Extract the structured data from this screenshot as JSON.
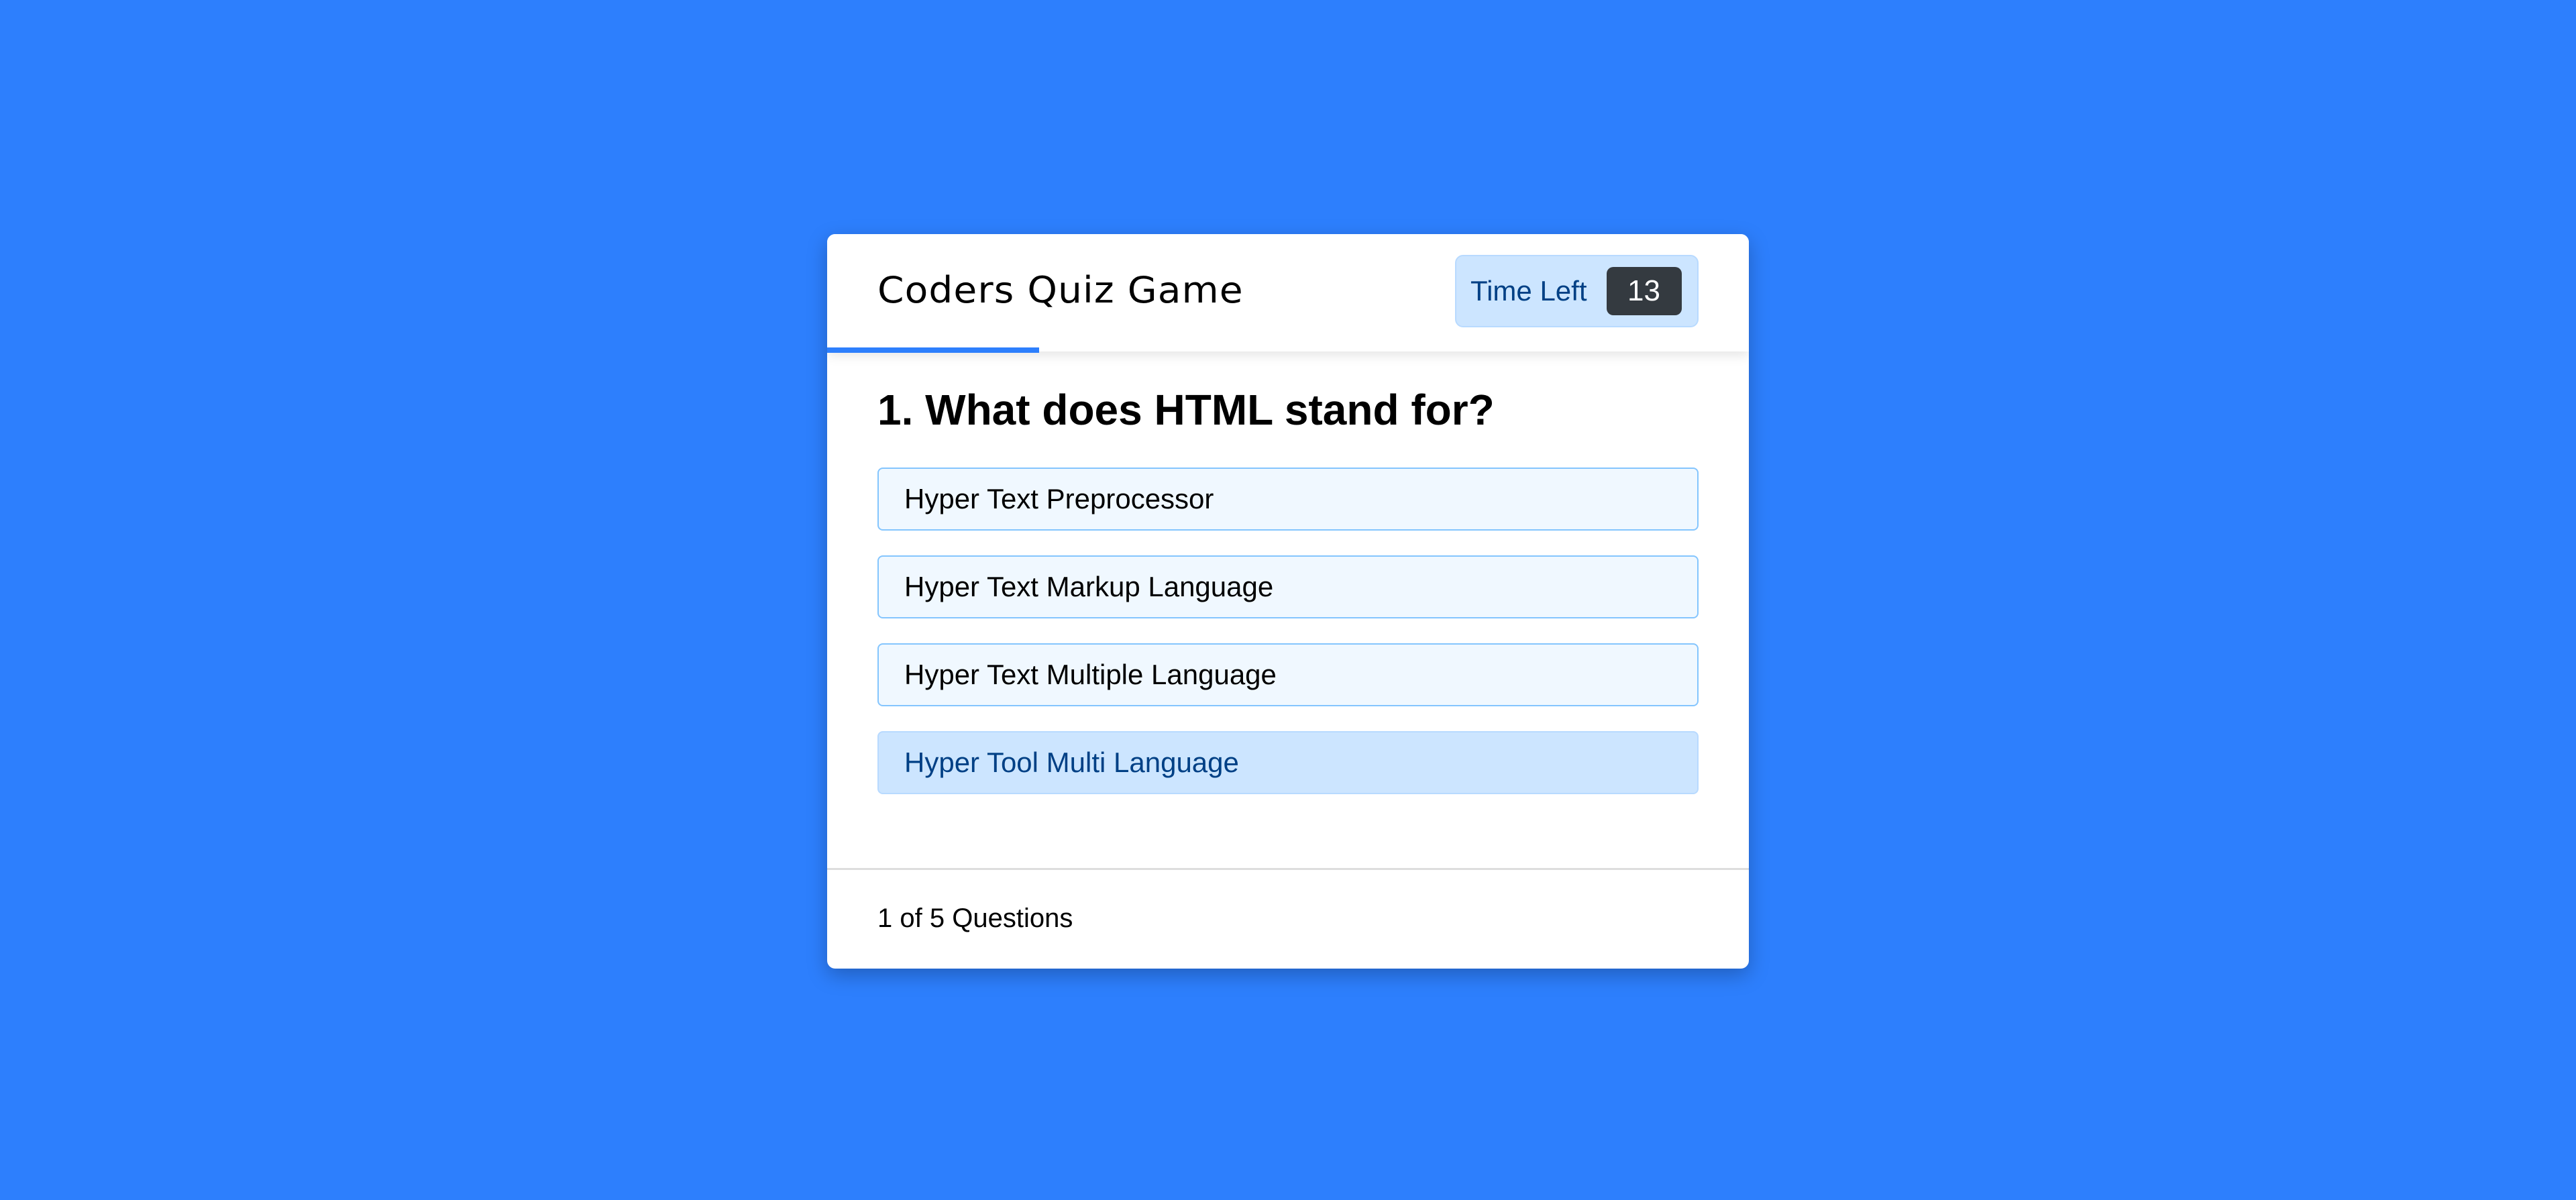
{
  "header": {
    "title": "Coders Quiz Game",
    "timer": {
      "label": "Time Left",
      "seconds": "13"
    },
    "time_progress": 0.23
  },
  "question": {
    "text": "1. What does HTML stand for?",
    "options": [
      {
        "label": "Hyper Text Preprocessor"
      },
      {
        "label": "Hyper Text Markup Language"
      },
      {
        "label": "Hyper Text Multiple Language"
      },
      {
        "label": "Hyper Tool Multi Language",
        "state": "hovered"
      }
    ]
  },
  "footer": {
    "current": "1",
    "of_word": "of",
    "total": "5",
    "suffix": "Questions"
  },
  "colors": {
    "background": "#2d7ffd",
    "timer_bg": "#cce5ff",
    "timer_badge": "#343a40",
    "option_bg": "#f0f8ff",
    "option_border": "#84c5fe",
    "option_hover_bg": "#cce5ff"
  }
}
